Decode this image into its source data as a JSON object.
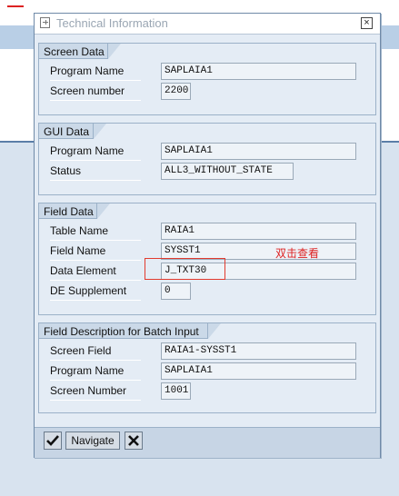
{
  "dialog": {
    "title": "Technical Information",
    "close_label": "×"
  },
  "groups": {
    "screen_data": {
      "title": "Screen Data",
      "rows": [
        {
          "label": "Program Name",
          "value": "SAPLAIA1"
        },
        {
          "label": "Screen number",
          "value": "2200"
        }
      ]
    },
    "gui_data": {
      "title": "GUI Data",
      "rows": [
        {
          "label": "Program Name",
          "value": "SAPLAIA1"
        },
        {
          "label": "Status",
          "value": "ALL3_WITHOUT_STATE"
        }
      ]
    },
    "field_data": {
      "title": "Field Data",
      "rows": [
        {
          "label": "Table Name",
          "value": "RAIA1"
        },
        {
          "label": "Field Name",
          "value": "SYSST1"
        },
        {
          "label": "Data Element",
          "value": "J_TXT30"
        },
        {
          "label": "DE Supplement",
          "value": "0"
        }
      ]
    },
    "batch_input": {
      "title": "Field Description for Batch Input",
      "rows": [
        {
          "label": "Screen Field",
          "value": "RAIA1-SYSST1"
        },
        {
          "label": "Program Name",
          "value": "SAPLAIA1"
        },
        {
          "label": "Screen Number",
          "value": "1001"
        }
      ]
    }
  },
  "annotation": {
    "note": "双击查看",
    "color": "#dd2222"
  },
  "footer": {
    "confirm_icon": "checkmark-icon",
    "navigate_label": "Navigate",
    "cancel_icon": "cross-icon"
  }
}
